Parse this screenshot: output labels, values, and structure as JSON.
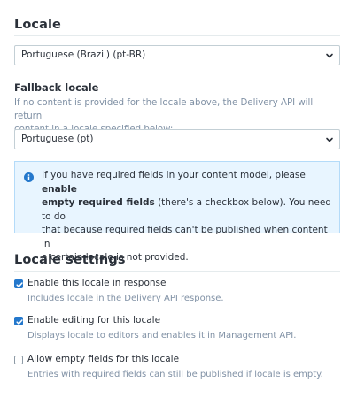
{
  "locale_section": {
    "title": "Locale",
    "selected": "Portuguese (Brazil) (pt-BR)"
  },
  "fallback": {
    "label": "Fallback locale",
    "help_line1": "If no content is provided for the locale above, the Delivery API will return",
    "help_line2": "content in a locale specified below:",
    "selected": "Portuguese (pt)"
  },
  "note": {
    "line1_pre": "If you have required fields in your content model, please ",
    "line1_bold": "enable",
    "line2_bold": "empty required fields",
    "line2_post": " (there's a checkbox below). You need to do",
    "line3": "that because required fields can't be published when content in",
    "line4": "a certain locale is not provided."
  },
  "settings": {
    "title": "Locale settings",
    "items": [
      {
        "label": "Enable this locale in response",
        "help": "Includes locale in the Delivery API response.",
        "checked": true
      },
      {
        "label": "Enable editing for this locale",
        "help": "Displays locale to editors and enables it in Management API.",
        "checked": true
      },
      {
        "label": "Allow empty fields for this locale",
        "help": "Entries with required fields can still be published if locale is empty.",
        "checked": false
      }
    ]
  },
  "colors": {
    "accent": "#2478cc",
    "note_bg": "#e8f5ff",
    "note_border": "#b4dbf9",
    "muted_text": "#8091a5"
  }
}
